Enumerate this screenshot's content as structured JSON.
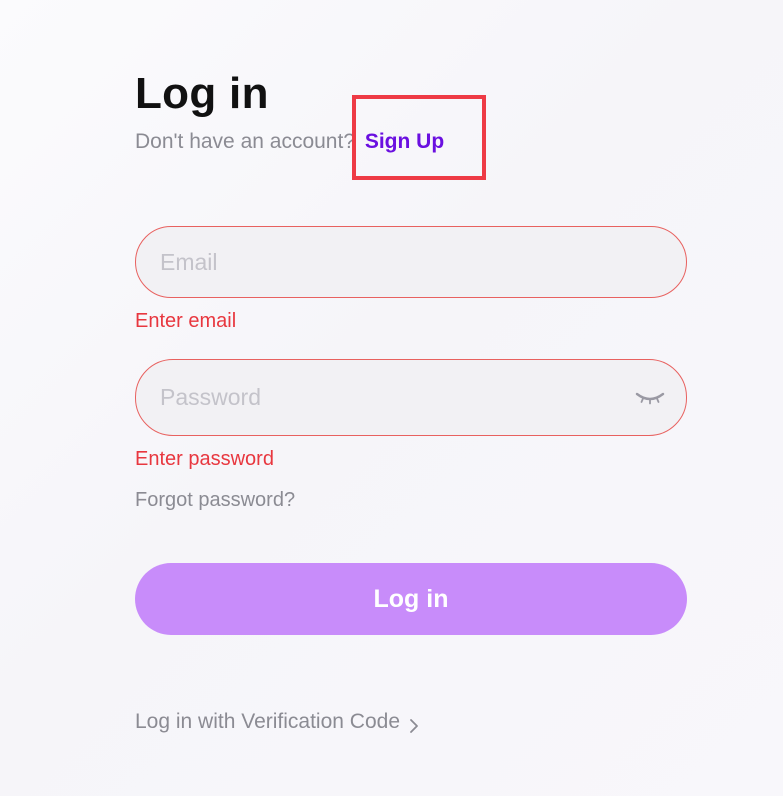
{
  "form": {
    "title": "Log in",
    "subline_text": "Don't have an account?",
    "signup_link": "Sign Up",
    "email": {
      "placeholder": "Email",
      "value": "",
      "error": "Enter email"
    },
    "password": {
      "placeholder": "Password",
      "value": "",
      "error": "Enter password",
      "toggle_icon": "eye-closed-icon"
    },
    "forgot_link": "Forgot password?",
    "login_button": "Log in",
    "verification_link": "Log in with Verification Code",
    "verification_icon": "chevron-right-icon"
  },
  "colors": {
    "accent": "#6a0fe0",
    "button": "#c88cfa",
    "error": "#e8373f",
    "highlight": "#ee3a45",
    "muted_text": "#8b8b93"
  }
}
